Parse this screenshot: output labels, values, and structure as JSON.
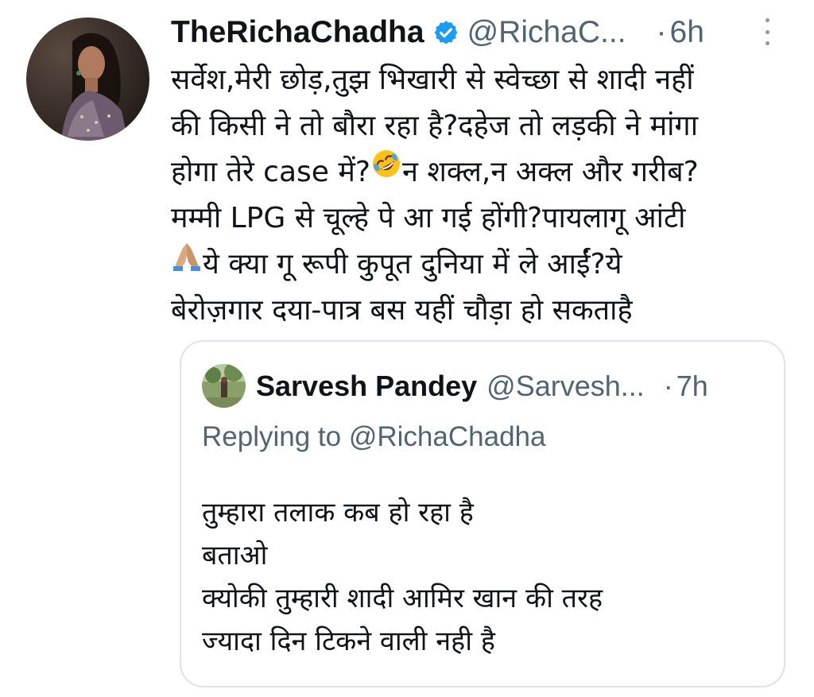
{
  "tweet": {
    "display_name": "TheRichaChadha",
    "handle": "@RichaC...",
    "separator": "·",
    "time": "6h",
    "lines": [
      "सर्वेश,मेरी छोड़,तुझ भिखारी से स्वेच्छा से शादी नहीं",
      "की किसी ने तो बौरा रहा है?दहेज तो लड़की ने मांगा",
      "होगा तेरे case में?",
      "न शक्ल,न अक्ल और गरीब?",
      "मम्मी LPG से चूल्हे पे आ गई होंगी?पायलागू आंटी",
      "ये क्या गू रूपी कुपूत दुनिया में ले आईं?ये",
      "बेरोज़गार दया-पात्र बस यहीं चौड़ा हो सकताहै"
    ]
  },
  "quoted_tweet": {
    "display_name": "Sarvesh Pandey",
    "handle": "@Sarvesh...",
    "separator": "·",
    "time": "7h",
    "replying_prefix": "Replying to",
    "replying_to": "@RichaChadha",
    "lines": [
      "तुम्हारा तलाक कब हो रहा है",
      "बताओ",
      "क्योकी तुम्हारी शादी आमिर खान की तरह",
      "ज्यादा दिन टिकने वाली नही है"
    ]
  },
  "icons": {
    "verified": "verified-badge-icon",
    "more": "more-options-icon",
    "laughing": "rolling-on-floor-laughing-emoji",
    "folded_hands": "folded-hands-emoji"
  },
  "colors": {
    "primary_text": "#0f1419",
    "secondary_text": "#536471",
    "verified": "#1d9bf0",
    "border": "#dde3e8"
  }
}
